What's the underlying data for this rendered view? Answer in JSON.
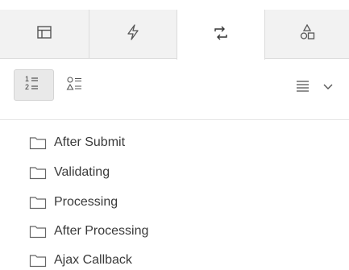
{
  "tabs": [
    {
      "icon": "table-icon",
      "active": false
    },
    {
      "icon": "lightning-icon",
      "active": false
    },
    {
      "icon": "swap-arrows-icon",
      "active": true
    },
    {
      "icon": "shapes-icon",
      "active": false
    }
  ],
  "toolbar": {
    "order_button_text": "1 = 2 =",
    "type_button_icon": "shapes-list-icon",
    "menu_icon": "hamburger-icon",
    "menu_chevron_icon": "chevron-down-icon"
  },
  "tree": {
    "items": [
      {
        "label": "After Submit",
        "icon": "folder-icon"
      },
      {
        "label": "Validating",
        "icon": "folder-icon"
      },
      {
        "label": "Processing",
        "icon": "folder-icon"
      },
      {
        "label": "After Processing",
        "icon": "folder-icon"
      },
      {
        "label": "Ajax Callback",
        "icon": "folder-icon"
      }
    ]
  }
}
